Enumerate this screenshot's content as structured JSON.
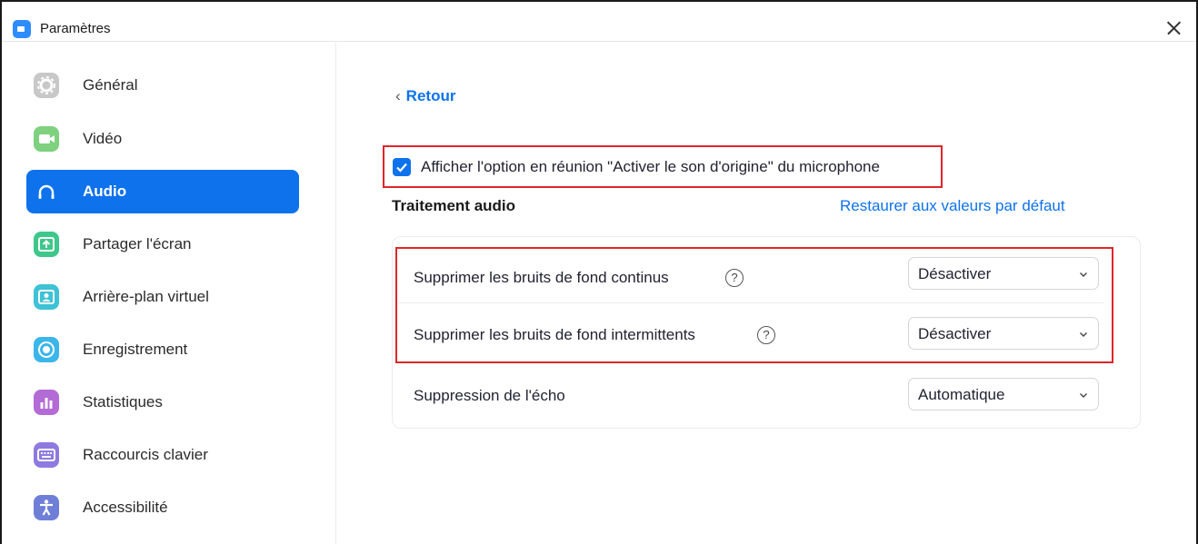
{
  "window": {
    "title": "Paramètres"
  },
  "sidebar": {
    "items": [
      {
        "label": "Général",
        "icon": "gear-icon",
        "color": "#c8c8c8"
      },
      {
        "label": "Vidéo",
        "icon": "video-camera-icon",
        "color": "#7ed17e"
      },
      {
        "label": "Audio",
        "icon": "headphones-icon",
        "color": "#0e72ed"
      },
      {
        "label": "Partager l'écran",
        "icon": "share-screen-icon",
        "color": "#3ec78a"
      },
      {
        "label": "Arrière-plan virtuel",
        "icon": "virtual-background-icon",
        "color": "#3ec2d6"
      },
      {
        "label": "Enregistrement",
        "icon": "record-icon",
        "color": "#3bb6ea"
      },
      {
        "label": "Statistiques",
        "icon": "statistics-icon",
        "color": "#b36bd6"
      },
      {
        "label": "Raccourcis clavier",
        "icon": "keyboard-icon",
        "color": "#8e7ae0"
      },
      {
        "label": "Accessibilité",
        "icon": "accessibility-icon",
        "color": "#6f7fd8"
      }
    ],
    "active_index": 2
  },
  "main": {
    "back_label": "Retour",
    "original_sound": {
      "label": "Afficher l'option en réunion \"Activer le son d'origine\" du microphone",
      "checked": true
    },
    "section_title": "Traitement audio",
    "restore_label": "Restaurer aux valeurs par défaut",
    "settings": [
      {
        "label": "Supprimer les bruits de fond continus",
        "value": "Désactiver",
        "has_help": true
      },
      {
        "label": "Supprimer les bruits de fond intermittents",
        "value": "Désactiver",
        "has_help": true
      },
      {
        "label": "Suppression de l'écho",
        "value": "Automatique",
        "has_help": false
      }
    ]
  },
  "colors": {
    "accent": "#0e72ed",
    "highlight": "#e0252b"
  }
}
